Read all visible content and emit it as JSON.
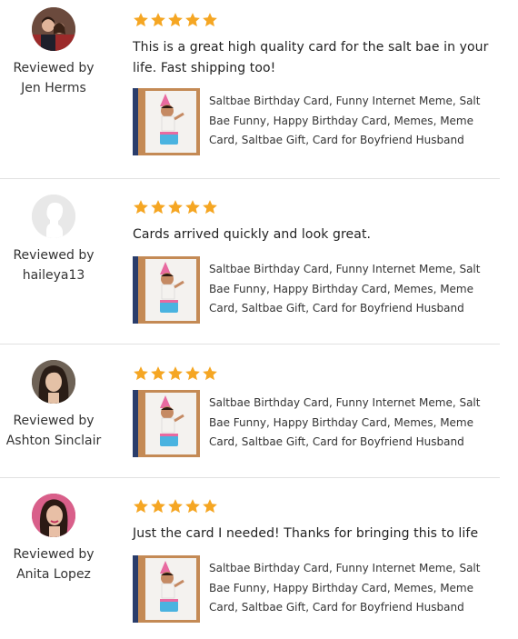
{
  "reviews": [
    {
      "reviewed_by_label": "Reviewed by",
      "reviewer": "Jen Herms",
      "avatar": "couple-photo",
      "rating": 5,
      "text": "This is a great high quality card for the salt bae in your life. Fast shipping too!",
      "item_title": "Saltbae Birthday Card, Funny Internet Meme, Salt Bae Funny, Happy Birthday Card, Memes, Meme Card, Saltbae Gift, Card for Boyfriend Husband"
    },
    {
      "reviewed_by_label": "Reviewed by",
      "reviewer": "haileya13",
      "avatar": "default-user-silhouette",
      "rating": 5,
      "text": "Cards arrived quickly and look great.",
      "item_title": "Saltbae Birthday Card, Funny Internet Meme, Salt Bae Funny, Happy Birthday Card, Memes, Meme Card, Saltbae Gift, Card for Boyfriend Husband"
    },
    {
      "reviewed_by_label": "Reviewed by",
      "reviewer": "Ashton Sinclair",
      "avatar": "woman-photo",
      "rating": 5,
      "text": "",
      "item_title": "Saltbae Birthday Card, Funny Internet Meme, Salt Bae Funny, Happy Birthday Card, Memes, Meme Card, Saltbae Gift, Card for Boyfriend Husband"
    },
    {
      "reviewed_by_label": "Reviewed by",
      "reviewer": "Anita Lopez",
      "avatar": "woman-photo",
      "rating": 5,
      "text": "Just the card I needed! Thanks for bringing this to life",
      "item_title": "Saltbae Birthday Card, Funny Internet Meme, Salt Bae Funny, Happy Birthday Card, Memes, Meme Card, Saltbae Gift, Card for Boyfriend Husband"
    }
  ],
  "colors": {
    "star": "#f5a623",
    "divider": "#e1e1e1",
    "text": "#222222"
  }
}
